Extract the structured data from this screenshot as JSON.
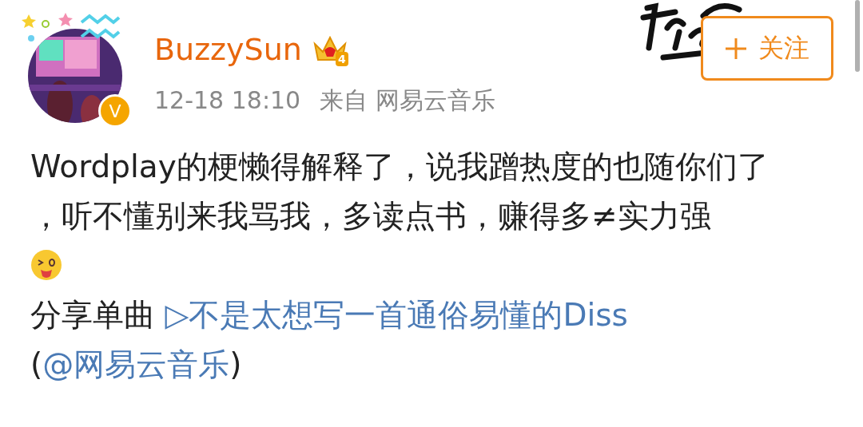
{
  "post": {
    "author": {
      "name": "BuzzySun",
      "member_level": "4",
      "verified_mark": "V"
    },
    "time": "12-18 18:10",
    "source_prefix": "来自",
    "source": "网易云音乐",
    "follow_button": {
      "label": "关注"
    },
    "paragraphs": [
      "Wordplay的梗懒得解释了，说我蹭热度的也随你们了",
      "，听不懂别来我骂我，多读点书，赚得多≠实力强"
    ],
    "share": {
      "prefix": "分享单曲",
      "song_link": "▷不是太想写一首通俗易懂的Diss",
      "open_paren": "(",
      "mention_link": "@网易云音乐",
      "close_paren": ")"
    }
  }
}
